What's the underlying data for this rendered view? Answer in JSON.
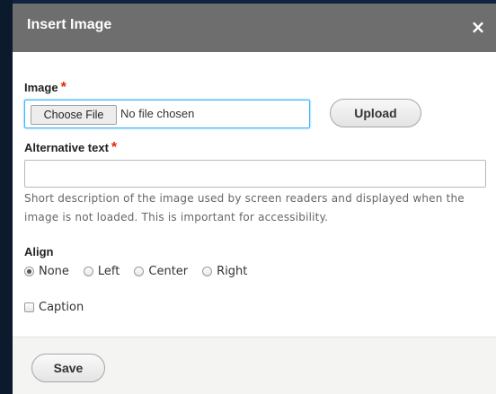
{
  "dialog": {
    "title": "Insert Image",
    "close_glyph": "×"
  },
  "image_field": {
    "label": "Image",
    "required_mark": "*",
    "choose_button": "Choose File",
    "file_status": "No file chosen",
    "upload_button": "Upload"
  },
  "alt_field": {
    "label": "Alternative text",
    "required_mark": "*",
    "value": "",
    "description": "Short description of the image used by screen readers and displayed when the image is not loaded. This is important for accessibility."
  },
  "align": {
    "label": "Align",
    "options": [
      {
        "label": "None",
        "selected": true
      },
      {
        "label": "Left",
        "selected": false
      },
      {
        "label": "Center",
        "selected": false
      },
      {
        "label": "Right",
        "selected": false
      }
    ]
  },
  "caption": {
    "label": "Caption",
    "checked": false
  },
  "footer": {
    "save_button": "Save"
  },
  "colors": {
    "titlebar": "#6e6e6e",
    "required": "#e32700",
    "focus": "#40b6ff"
  }
}
